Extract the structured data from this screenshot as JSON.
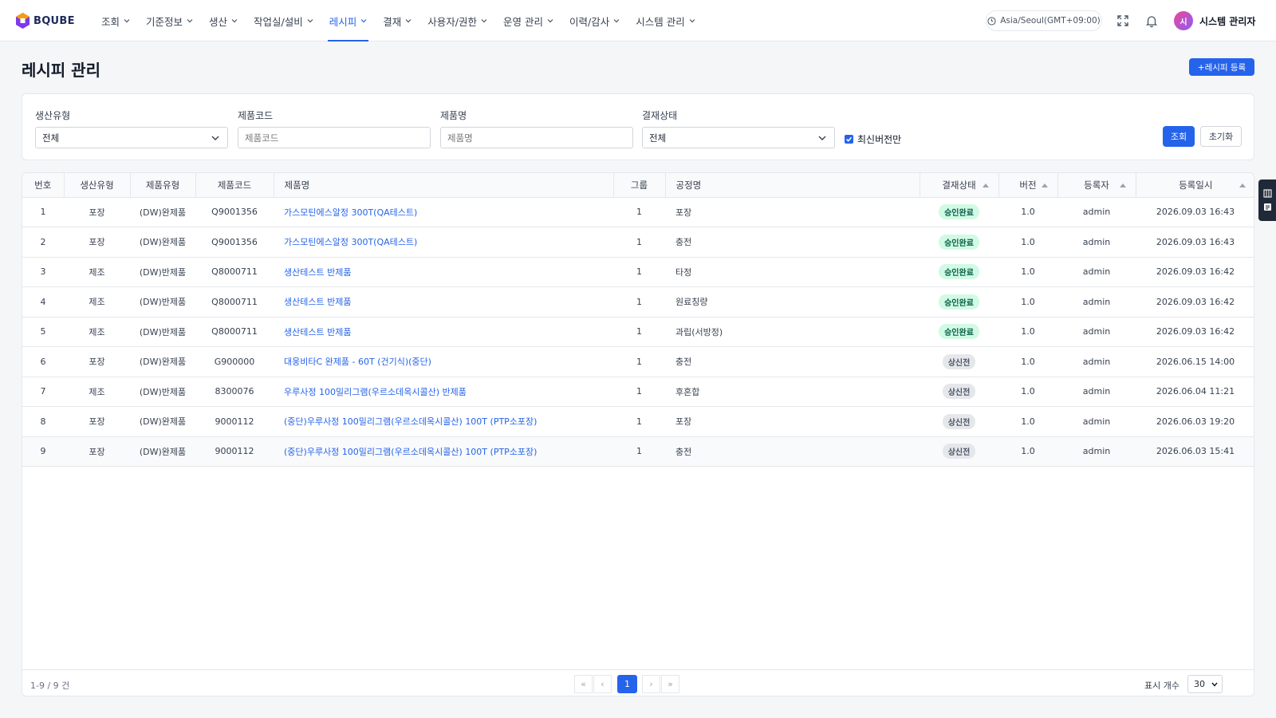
{
  "brand": {
    "name": "BQUBE",
    "accent": "#2563eb",
    "logo_colors": [
      "#f59e0b",
      "#7c3aed"
    ]
  },
  "nav": [
    {
      "label": "조회",
      "active": false
    },
    {
      "label": "기준정보",
      "active": false
    },
    {
      "label": "생산",
      "active": false
    },
    {
      "label": "작업실/설비",
      "active": false
    },
    {
      "label": "레시피",
      "active": true
    },
    {
      "label": "결재",
      "active": false
    },
    {
      "label": "사용자/권한",
      "active": false
    },
    {
      "label": "운영 관리",
      "active": false
    },
    {
      "label": "이력/감사",
      "active": false
    },
    {
      "label": "시스템 관리",
      "active": false
    }
  ],
  "header": {
    "timezone": "Asia/Seoul(GMT+09:00)",
    "user_initial": "시",
    "user_name": "시스템 관리자",
    "icons": [
      "clock-icon",
      "fullscreen-icon",
      "bell-icon"
    ]
  },
  "page": {
    "title": "레시피 관리",
    "register_label": "+레시피 등록"
  },
  "filters": {
    "production_type": {
      "label": "생산유형",
      "value": "전체"
    },
    "product_code": {
      "label": "제품코드",
      "placeholder": "제품코드"
    },
    "product_name": {
      "label": "제품명",
      "placeholder": "제품명"
    },
    "approval_status": {
      "label": "결재상태",
      "value": "전체"
    },
    "latest_only": {
      "label": "최신버전만",
      "checked": true
    },
    "search_label": "조회",
    "reset_label": "초기화"
  },
  "table": {
    "columns": [
      "번호",
      "생산유형",
      "제품유형",
      "제품코드",
      "제품명",
      "그룹",
      "공정명",
      "결재상태",
      "버전",
      "등록자",
      "등록일시"
    ],
    "rows": [
      [
        "1",
        "포장",
        "(DW)완제품",
        "Q9001356",
        "가스모틴에스알정 300T(QA테스트)",
        "1",
        "포장",
        "승인완료",
        "1.0",
        "admin",
        "2026.09.03 16:43"
      ],
      [
        "2",
        "포장",
        "(DW)완제품",
        "Q9001356",
        "가스모틴에스알정 300T(QA테스트)",
        "1",
        "충전",
        "승인완료",
        "1.0",
        "admin",
        "2026.09.03 16:43"
      ],
      [
        "3",
        "제조",
        "(DW)반제품",
        "Q8000711",
        "생산테스트 반제품",
        "1",
        "타정",
        "승인완료",
        "1.0",
        "admin",
        "2026.09.03 16:42"
      ],
      [
        "4",
        "제조",
        "(DW)반제품",
        "Q8000711",
        "생산테스트 반제품",
        "1",
        "원료칭량",
        "승인완료",
        "1.0",
        "admin",
        "2026.09.03 16:42"
      ],
      [
        "5",
        "제조",
        "(DW)반제품",
        "Q8000711",
        "생산테스트 반제품",
        "1",
        "과립(서방정)",
        "승인완료",
        "1.0",
        "admin",
        "2026.09.03 16:42"
      ],
      [
        "6",
        "포장",
        "(DW)완제품",
        "G900000",
        "대웅비타C 완제품 - 60T (건기식)(중단)",
        "1",
        "충전",
        "상신전",
        "1.0",
        "admin",
        "2026.06.15 14:00"
      ],
      [
        "7",
        "제조",
        "(DW)반제품",
        "8300076",
        "우루사정 100밀리그램(우르소데옥시콜산) 반제품",
        "1",
        "후혼합",
        "상신전",
        "1.0",
        "admin",
        "2026.06.04 11:21"
      ],
      [
        "8",
        "포장",
        "(DW)완제품",
        "9000112",
        "(중단)우루사정 100밀리그램(우르소데옥시콜산) 100T (PTP소포장)",
        "1",
        "포장",
        "상신전",
        "1.0",
        "admin",
        "2026.06.03 19:20"
      ],
      [
        "9",
        "포장",
        "(DW)완제품",
        "9000112",
        "(중단)우루사정 100밀리그램(우르소데옥시콜산) 100T (PTP소포장)",
        "1",
        "충전",
        "상신전",
        "1.0",
        "admin",
        "2026.06.03 15:41"
      ]
    ],
    "sortable_columns": [
      "결재상태",
      "버전",
      "등록자",
      "등록일시"
    ]
  },
  "footer": {
    "range": "1-9 / 9 건",
    "pager": {
      "first": "«",
      "prev": "‹",
      "current": "1",
      "next": "›",
      "last": "»"
    },
    "page_size_label": "표시 개수",
    "page_size": "30"
  }
}
